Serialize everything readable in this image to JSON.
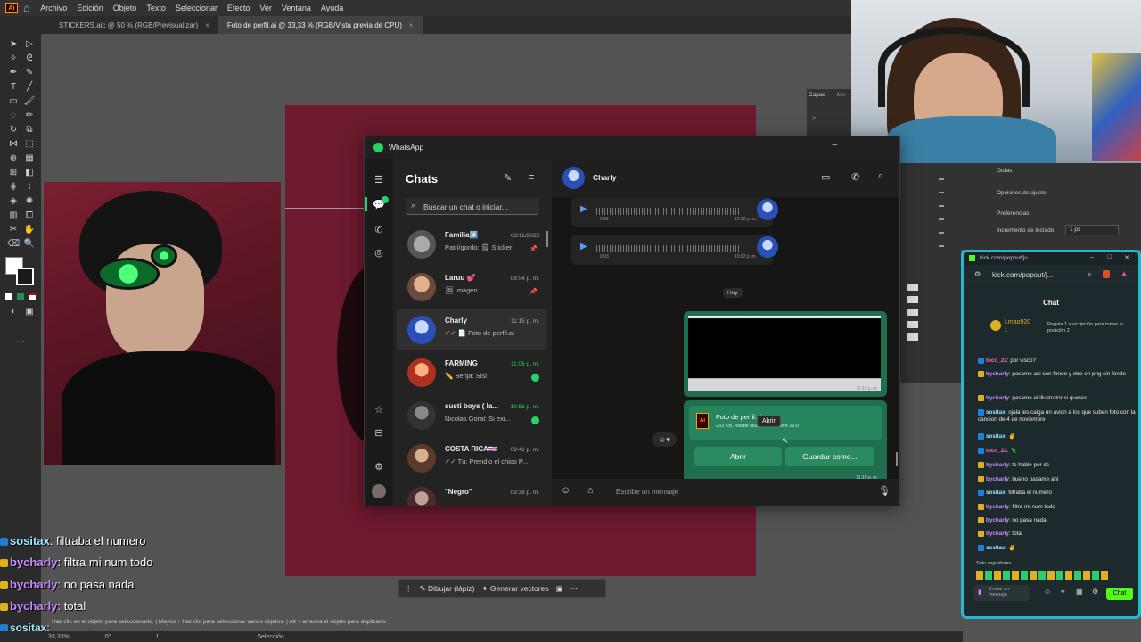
{
  "illustrator": {
    "menu": [
      "Archivo",
      "Edición",
      "Objeto",
      "Texto",
      "Seleccionar",
      "Efecto",
      "Ver",
      "Ventana",
      "Ayuda"
    ],
    "logo": "Ai",
    "tabs": [
      {
        "label": "STICKERS.aic @ 50 % (RGB/Previsualizar)",
        "close": "×"
      },
      {
        "label": "Foto de perfil.ai @ 33,33 % (RGB/Vista previa de CPU)",
        "close": "×"
      }
    ],
    "context_bar": {
      "draw": "Dibujar (lápiz)",
      "vectors": "Generar vectores"
    },
    "hint": "Haz clic en el objeto para seleccionarlo. | Mayús + haz clic para seleccionar varios objetos. | Alt + arrastra el objeto para duplicarlo.",
    "status": {
      "zoom": "33,33%",
      "angle": "0°",
      "artboard": "1",
      "mode": "Selección"
    },
    "panels": {
      "tab1": "Capas",
      "tab2": "Me",
      "guides": "Guías",
      "snap": "Opciones de ajuste",
      "prefs": "Preferencias",
      "keyboard": "Incremento de teclado:",
      "keyboard_value": "1 px"
    }
  },
  "whatsapp": {
    "title": "WhatsApp",
    "minimize": "–",
    "list_title": "Chats",
    "search_placeholder": "Buscar un chat o iniciar...",
    "chats": [
      {
        "name": "Familia4️⃣",
        "time": "02/11/2025",
        "msg": "Patri/gordo: 🗒 Sticker",
        "pinned": true
      },
      {
        "name": "Laruu 💕",
        "time": "09:54 p. m.",
        "msg": "🖼 Imagen",
        "pinned": true
      },
      {
        "name": "Charly",
        "time": "11:15 p. m.",
        "msg": "✓✓ 📄 Foto de perfil.ai",
        "selected": true
      },
      {
        "name": "FARMING",
        "time": "11:06 p. m.",
        "msg": "✏️ Benja: Sisi",
        "unread": true
      },
      {
        "name": "susti boys ( la...",
        "time": "10:56 p. m.",
        "msg": "Nicolas Goral: Si exi...",
        "unread": true
      },
      {
        "name": "COSTA RICA🇨🇷",
        "time": "09:41 p. m.",
        "msg": "✓✓ Tú: Prendio el chico P..."
      },
      {
        "name": "\"Negro\"",
        "time": "09:38 p. m.",
        "msg": ""
      }
    ],
    "chat": {
      "contact": "Charly",
      "voice_msgs": [
        {
          "duration": "0:02",
          "time": "10:02 p. m."
        },
        {
          "duration": "0:03",
          "time": "10:02 p. m."
        }
      ],
      "day_label": "Hoy",
      "image_time": "11:15 p. m.",
      "file_name": "Foto de perfil.ai",
      "file_meta": "233 KB, Adobe Illustrator Artwork 29.0",
      "tooltip": "Abrir",
      "open_btn": "Abrir",
      "save_btn": "Guardar como...",
      "file_time": "11:15 p. m.",
      "compose_placeholder": "Escribe un mensaje"
    }
  },
  "kick": {
    "url_title": "kick.com/popout/ju...",
    "url": "kick.com/popout/j...",
    "header": "Chat",
    "top_user": "Lmao920",
    "top_user_count": "1",
    "top_sub_text": "Regala 1 suscripción para tomar la posición 2",
    "messages": [
      {
        "user": "tuco_22",
        "text": "por visco?",
        "color": "pink"
      },
      {
        "user": "bycharly",
        "text": "pasame asi con fondo y otro en png sin fondo",
        "color": "purple"
      },
      {
        "user": "bycharly",
        "text": "pasame el illustrator si queres",
        "color": "purple"
      },
      {
        "user": "sositax",
        "text": "ojala les caiga un avion a los que suben foto con la cancion de 4 de noviembre",
        "color": "cyan"
      },
      {
        "user": "sositax",
        "text": "",
        "color": "cyan"
      },
      {
        "user": "tuco_22",
        "text": "",
        "color": "pink"
      },
      {
        "user": "bycharly",
        "text": "te hable por ds",
        "color": "purple"
      },
      {
        "user": "bycharly",
        "text": "bueno pasame ahi",
        "color": "purple"
      },
      {
        "user": "sositax",
        "text": "filtraba el numero",
        "color": "cyan"
      },
      {
        "user": "bycharly",
        "text": "filtra mi num todo",
        "color": "purple"
      },
      {
        "user": "bycharly",
        "text": "no pasa nada",
        "color": "purple"
      },
      {
        "user": "bycharly",
        "text": "total",
        "color": "purple"
      },
      {
        "user": "sositax",
        "text": "",
        "color": "cyan"
      }
    ],
    "followers_only": "Solo seguidores",
    "send_placeholder": "Enviar un mensaje",
    "chat_btn": "Chat"
  },
  "overlay_chat": [
    {
      "user": "sositax",
      "text": "filtraba el numero"
    },
    {
      "user": "bycharly",
      "text": "filtra mi num todo"
    },
    {
      "user": "bycharly",
      "text": "no pasa nada"
    },
    {
      "user": "bycharly",
      "text": "total"
    },
    {
      "user": "sositax",
      "text": ""
    }
  ],
  "colors": {
    "whatsapp_green": "#25d366",
    "file_bubble": "#1f6e4d",
    "kick_border": "#25b8c8",
    "kick_green": "#53fc18",
    "artboard": "#6d1a2e"
  }
}
